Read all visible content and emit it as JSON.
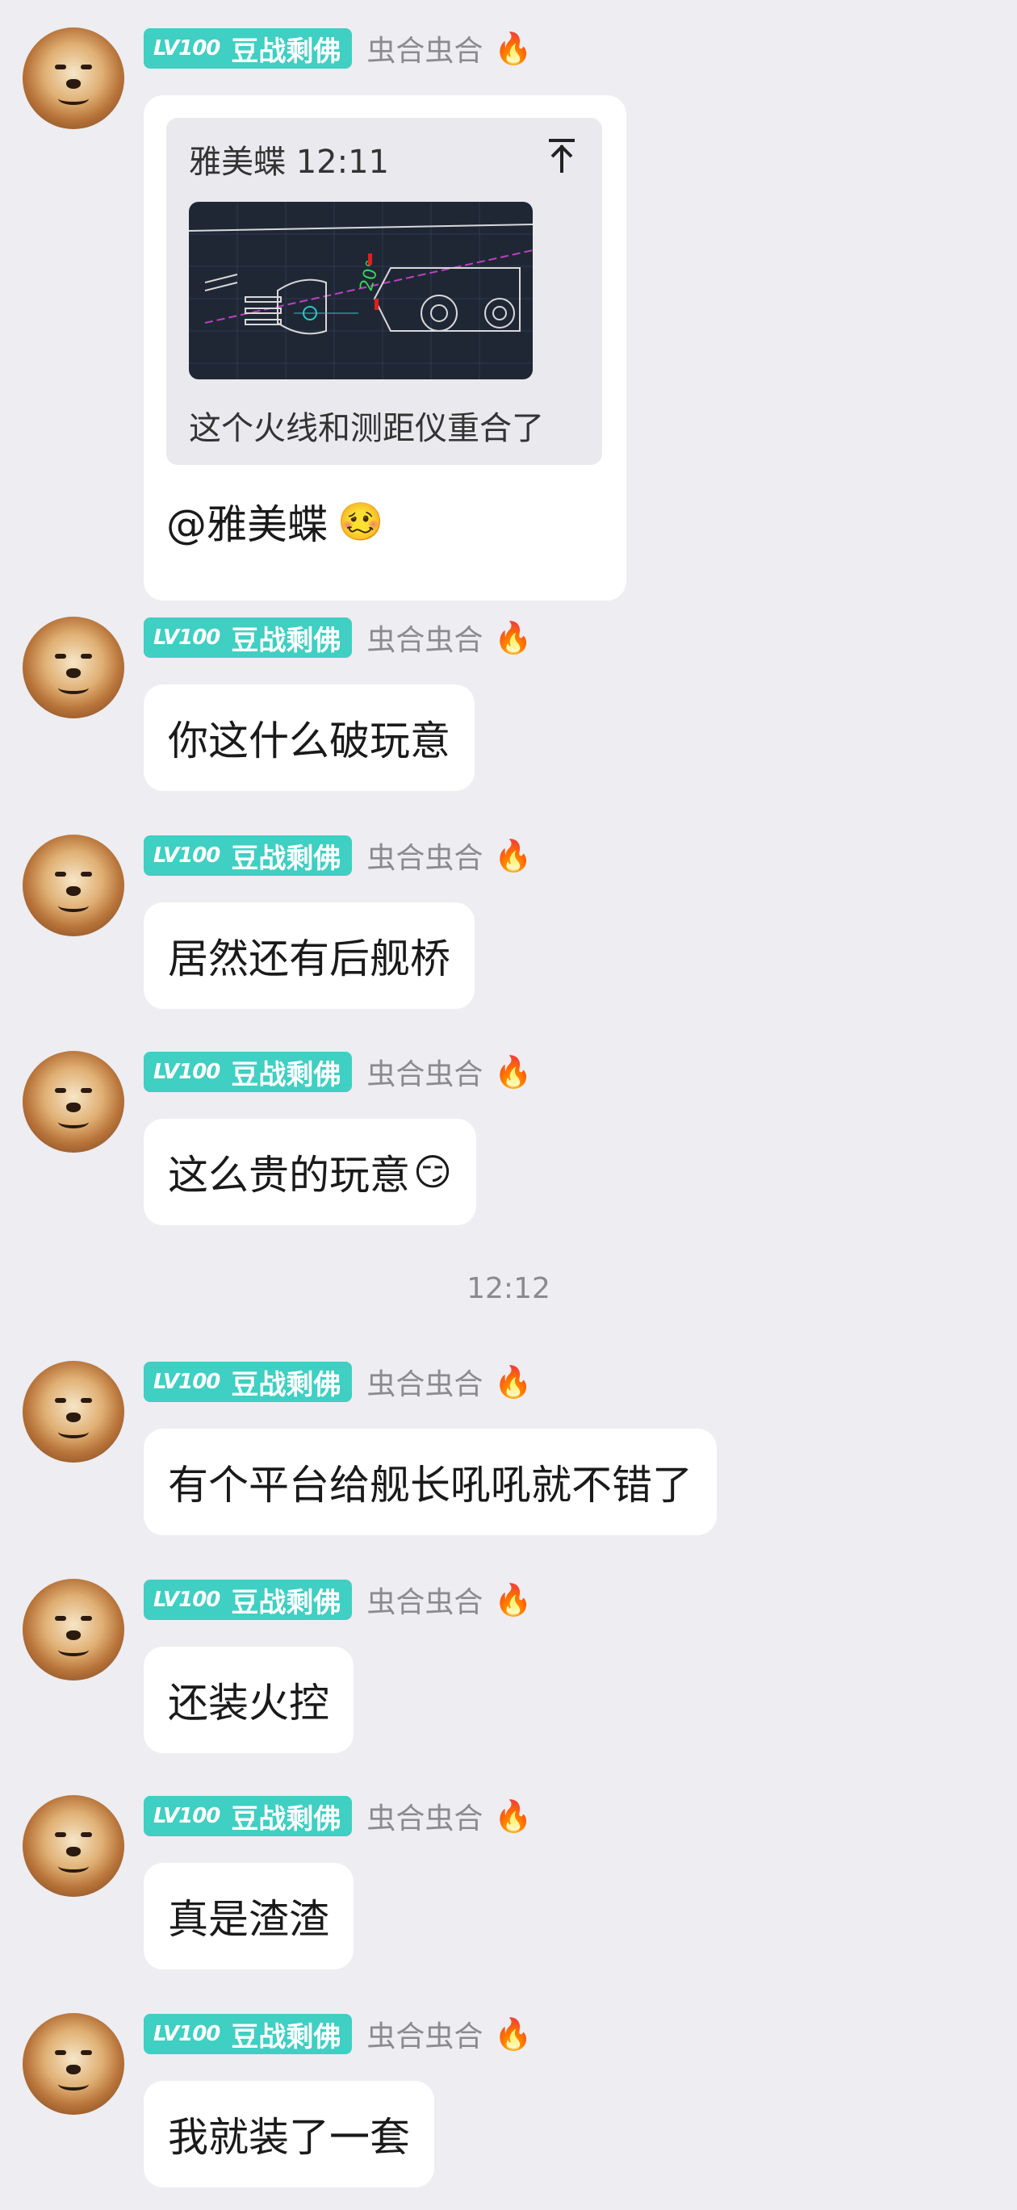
{
  "user": {
    "level": "LV100",
    "title": "豆战剩佛",
    "name": "虫合虫合",
    "flame_icon": "🔥"
  },
  "quoted": {
    "sender_time": "雅美蝶 12:11",
    "top_icon": "pin-top-icon",
    "caption": "这个火线和测距仪重合了",
    "image_annotation": "20°"
  },
  "mention_text": "@雅美蝶",
  "mention_emoji": "🥴",
  "messages": [
    {
      "text": "你这什么破玩意",
      "emoji": ""
    },
    {
      "text": "居然还有后舰桥",
      "emoji": ""
    },
    {
      "text": "这么贵的玩意",
      "emoji": "😏"
    },
    {
      "text": "有个平台给舰长吼吼就不错了",
      "emoji": ""
    },
    {
      "text": "还装火控",
      "emoji": ""
    },
    {
      "text": "真是渣渣",
      "emoji": ""
    },
    {
      "text": "我就装了一套",
      "emoji": ""
    }
  ],
  "timestamp": "12:12",
  "colors": {
    "background": "#ededf2",
    "badge": "#3fcfc3",
    "bubble": "#ffffff",
    "meta_text": "#8a8a8f"
  }
}
